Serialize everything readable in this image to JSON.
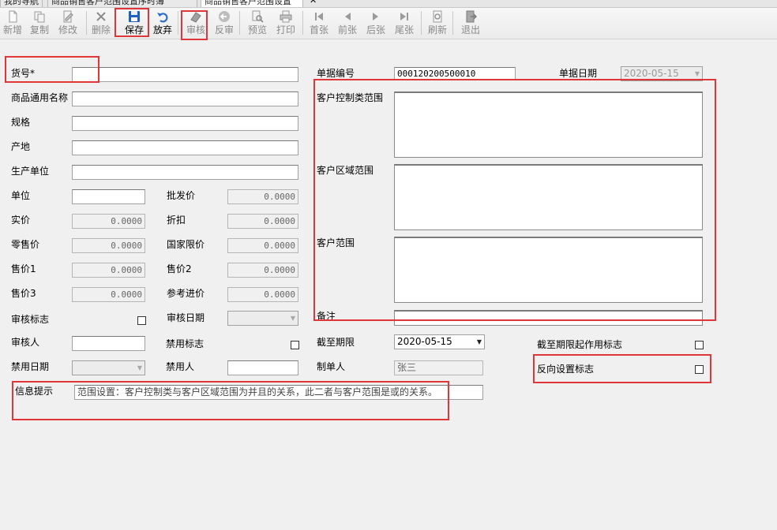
{
  "tabs": [
    {
      "label": "我的导航"
    },
    {
      "label": "商品销售客户范围设置序时簿"
    },
    {
      "label": "商品销售客户范围设置"
    }
  ],
  "tab_close": "✕",
  "toolbar": {
    "new": "新增",
    "copy": "复制",
    "modify": "修改",
    "delete": "删除",
    "save": "保存",
    "discard": "放弃",
    "audit": "审核",
    "unaudit": "反审",
    "preview": "预览",
    "print": "打印",
    "first": "首张",
    "prev": "前张",
    "next": "后张",
    "last": "尾张",
    "refresh": "刷新",
    "exit": "退出"
  },
  "left": {
    "item_no_label": "货号*",
    "generic_name_label": "商品通用名称",
    "spec_label": "规格",
    "origin_label": "产地",
    "manufacturer_label": "生产单位",
    "unit_label": "单位",
    "wholesale_label": "批发价",
    "wholesale_value": "0.0000",
    "actual_price_label": "实价",
    "actual_price_value": "0.0000",
    "discount_label": "折扣",
    "discount_value": "0.0000",
    "retail_label": "零售价",
    "retail_value": "0.0000",
    "state_limit_label": "国家限价",
    "state_limit_value": "0.0000",
    "price1_label": "售价1",
    "price1_value": "0.0000",
    "price2_label": "售价2",
    "price2_value": "0.0000",
    "price3_label": "售价3",
    "price3_value": "0.0000",
    "ref_purchase_label": "参考进价",
    "ref_purchase_value": "0.0000",
    "audit_flag_label": "审核标志",
    "audit_date_label": "审核日期",
    "auditor_label": "审核人",
    "disable_flag_label": "禁用标志",
    "disable_date_label": "禁用日期",
    "disabler_label": "禁用人",
    "info_label": "信息提示",
    "info_text": "范围设置：客户控制类与客户区域范围为并且的关系，此二者与客户范围是或的关系。"
  },
  "right": {
    "doc_no_label": "单据编号",
    "doc_no_value": "000120200500010",
    "doc_date_label": "单据日期",
    "doc_date_value": "2020-05-15",
    "cust_control_label": "客户控制类范围",
    "cust_region_label": "客户区域范围",
    "cust_range_label": "客户范围",
    "remark_label": "备注",
    "deadline_label": "截至期限",
    "deadline_value": "2020-05-15",
    "deadline_flag_label": "截至期限起作用标志",
    "creator_label": "制单人",
    "creator_value": "张三",
    "reverse_flag_label": "反向设置标志"
  },
  "colors": {
    "highlight": "#e0363a",
    "save_icon": "#1f5fbf",
    "discard_icon": "#2d6fc8"
  }
}
